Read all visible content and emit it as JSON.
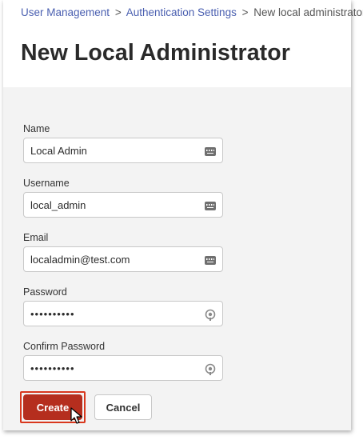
{
  "breadcrumb": {
    "items": [
      "User Management",
      "Authentication Settings"
    ],
    "separator": ">",
    "current": "New local administrator"
  },
  "page": {
    "title": "New Local Administrator"
  },
  "form": {
    "name": {
      "label": "Name",
      "value": "Local Admin",
      "icon": "keyboard-icon"
    },
    "username": {
      "label": "Username",
      "value": "local_admin",
      "icon": "keyboard-icon"
    },
    "email": {
      "label": "Email",
      "value": "localadmin@test.com",
      "icon": "keyboard-icon"
    },
    "password": {
      "label": "Password",
      "value": "••••••••••",
      "icon": "password-reveal-icon"
    },
    "confirm_password": {
      "label": "Confirm Password",
      "value": "••••••••••",
      "icon": "password-reveal-icon"
    }
  },
  "actions": {
    "create_label": "Create",
    "cancel_label": "Cancel"
  },
  "colors": {
    "link": "#4a5fb0",
    "primary": "#b52e1e",
    "highlight": "#d9381e",
    "panel": "#f3f3f3"
  }
}
